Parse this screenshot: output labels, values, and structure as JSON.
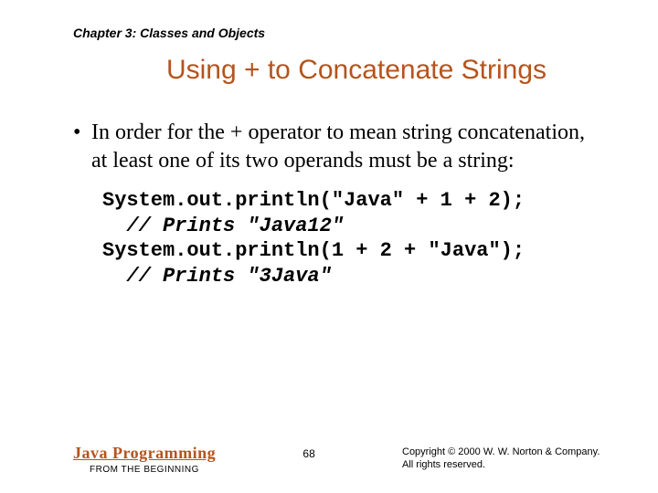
{
  "chapter": "Chapter 3: Classes and Objects",
  "title": "Using + to Concatenate Strings",
  "bullet": {
    "mark": "•",
    "text": "In order for the + operator to mean string concatenation, at least one of its two operands must be a string:"
  },
  "code": {
    "line1": "System.out.println(\"Java\" + 1 + 2);",
    "comment1": "  // Prints \"Java12\"",
    "line2": "System.out.println(1 + 2 + \"Java\");",
    "comment2": "  // Prints \"3Java\""
  },
  "footer": {
    "book_title": "Java Programming",
    "book_sub": "FROM THE BEGINNING",
    "page_number": "68",
    "copyright_line1": "Copyright © 2000 W. W. Norton & Company.",
    "copyright_line2": "All rights reserved."
  }
}
